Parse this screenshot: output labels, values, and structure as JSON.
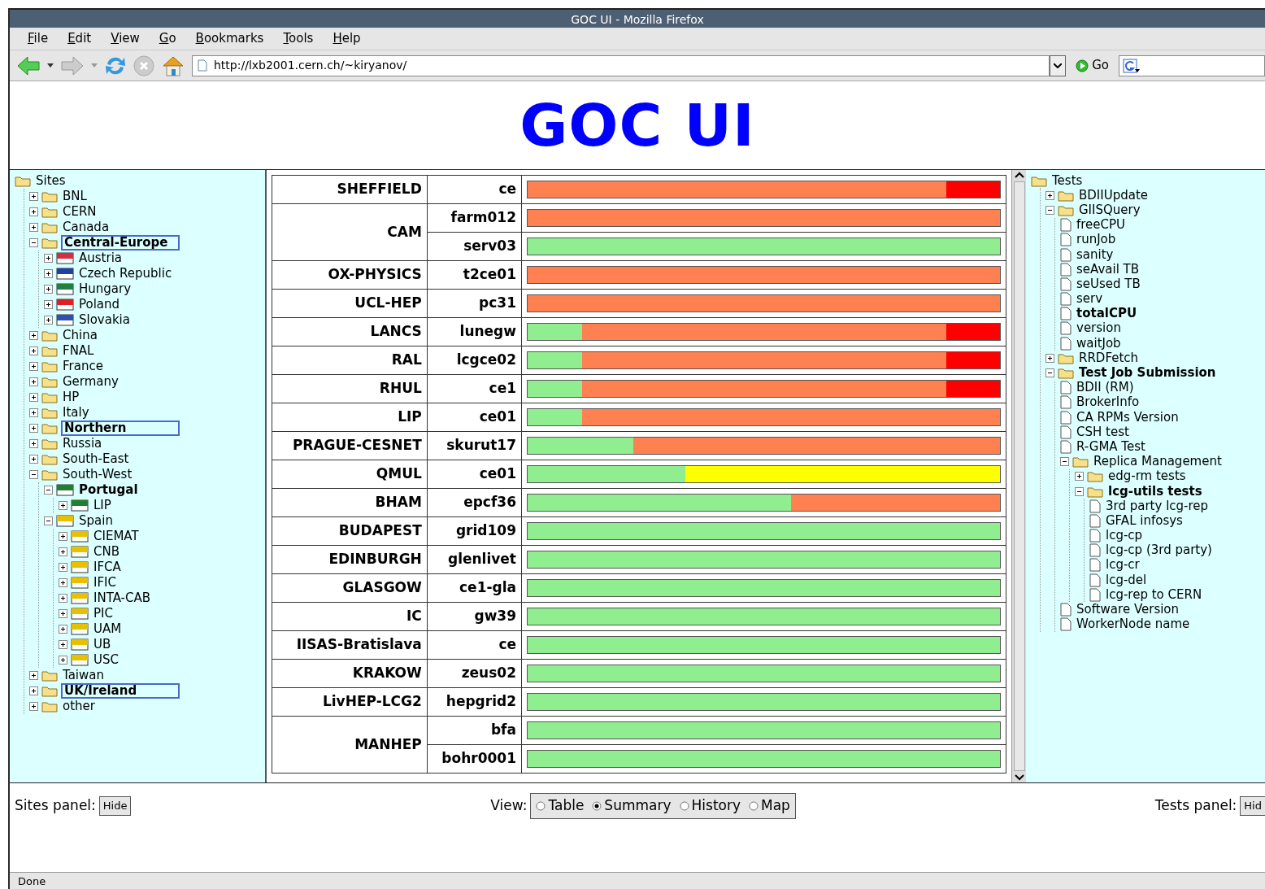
{
  "window": {
    "title": "GOC UI - Mozilla Firefox"
  },
  "menu": [
    "File",
    "Edit",
    "View",
    "Go",
    "Bookmarks",
    "Tools",
    "Help"
  ],
  "toolbar": {
    "address": "http://lxb2001.cern.ch/~kiryanov/",
    "go": "Go"
  },
  "page_title": "GOC UI",
  "sites_tree": {
    "label": "Sites",
    "kind": "folder",
    "children": [
      {
        "label": "BNL",
        "kind": "folder",
        "expanded": false
      },
      {
        "label": "CERN",
        "kind": "folder",
        "expanded": false
      },
      {
        "label": "Canada",
        "kind": "folder",
        "expanded": false
      },
      {
        "label": "Central-Europe",
        "kind": "folder",
        "expanded": true,
        "highlighted": true,
        "bold": true,
        "children": [
          {
            "label": "Austria",
            "kind": "flag",
            "color": "#d03040",
            "expanded": false
          },
          {
            "label": "Czech Republic",
            "kind": "flag",
            "color": "#2040a0",
            "expanded": false
          },
          {
            "label": "Hungary",
            "kind": "flag",
            "color": "#208040",
            "expanded": false
          },
          {
            "label": "Poland",
            "kind": "flag",
            "color": "#e02020",
            "expanded": false
          },
          {
            "label": "Slovakia",
            "kind": "flag",
            "color": "#3050b0",
            "expanded": false
          }
        ]
      },
      {
        "label": "China",
        "kind": "folder",
        "expanded": false
      },
      {
        "label": "FNAL",
        "kind": "folder",
        "expanded": false
      },
      {
        "label": "France",
        "kind": "folder",
        "expanded": false
      },
      {
        "label": "Germany",
        "kind": "folder",
        "expanded": false
      },
      {
        "label": "HP",
        "kind": "folder",
        "expanded": false
      },
      {
        "label": "Italy",
        "kind": "folder",
        "expanded": false
      },
      {
        "label": "Northern",
        "kind": "folder",
        "expanded": false,
        "highlighted": true,
        "bold": true
      },
      {
        "label": "Russia",
        "kind": "folder",
        "expanded": false
      },
      {
        "label": "South-East",
        "kind": "folder",
        "expanded": false
      },
      {
        "label": "South-West",
        "kind": "folder",
        "expanded": true,
        "children": [
          {
            "label": "Portugal",
            "kind": "flag",
            "color": "#208030",
            "expanded": true,
            "bold": true,
            "children": [
              {
                "label": "LIP",
                "kind": "flag",
                "color": "#208030",
                "expanded": false
              }
            ]
          },
          {
            "label": "Spain",
            "kind": "flag",
            "color": "#e8c000",
            "expanded": true,
            "children": [
              {
                "label": "CIEMAT",
                "kind": "flag",
                "color": "#e8c000",
                "expanded": false
              },
              {
                "label": "CNB",
                "kind": "flag",
                "color": "#e8c000",
                "expanded": false
              },
              {
                "label": "IFCA",
                "kind": "flag",
                "color": "#e8c000",
                "expanded": false
              },
              {
                "label": "IFIC",
                "kind": "flag",
                "color": "#e8c000",
                "expanded": false
              },
              {
                "label": "INTA-CAB",
                "kind": "flag",
                "color": "#e8c000",
                "expanded": false
              },
              {
                "label": "PIC",
                "kind": "flag",
                "color": "#e8c000",
                "expanded": false
              },
              {
                "label": "UAM",
                "kind": "flag",
                "color": "#e8c000",
                "expanded": false
              },
              {
                "label": "UB",
                "kind": "flag",
                "color": "#e8c000",
                "expanded": false
              },
              {
                "label": "USC",
                "kind": "flag",
                "color": "#e8c000",
                "expanded": false
              }
            ]
          }
        ]
      },
      {
        "label": "Taiwan",
        "kind": "folder",
        "expanded": false
      },
      {
        "label": "UK/Ireland",
        "kind": "folder",
        "expanded": false,
        "highlighted": true,
        "bold": true
      },
      {
        "label": "other",
        "kind": "folder",
        "expanded": false
      }
    ]
  },
  "summary": {
    "rows": [
      {
        "site": "SHEFFIELD",
        "hosts": [
          {
            "name": "ce",
            "segments": [
              {
                "color": "#ff8050",
                "level": 0.887
              },
              {
                "color": "#ff0000",
                "level": 1
              }
            ]
          }
        ]
      },
      {
        "site": "CAM",
        "hosts": [
          {
            "name": "farm012",
            "segments": [
              {
                "color": "#ff8050",
                "level": 1
              }
            ]
          },
          {
            "name": "serv03",
            "segments": [
              {
                "color": "#90ee90",
                "level": 1
              }
            ]
          }
        ]
      },
      {
        "site": "OX-PHYSICS",
        "hosts": [
          {
            "name": "t2ce01",
            "segments": [
              {
                "color": "#ff8050",
                "level": 1
              }
            ]
          }
        ]
      },
      {
        "site": "UCL-HEP",
        "hosts": [
          {
            "name": "pc31",
            "segments": [
              {
                "color": "#ff8050",
                "level": 1
              }
            ]
          }
        ]
      },
      {
        "site": "LANCS",
        "hosts": [
          {
            "name": "lunegw",
            "segments": [
              {
                "color": "#90ee90",
                "level": 0.115
              },
              {
                "color": "#ff8050",
                "level": 0.887
              },
              {
                "color": "#ff0000",
                "level": 1
              }
            ]
          }
        ]
      },
      {
        "site": "RAL",
        "hosts": [
          {
            "name": "lcgce02",
            "segments": [
              {
                "color": "#90ee90",
                "level": 0.115
              },
              {
                "color": "#ff8050",
                "level": 0.887
              },
              {
                "color": "#ff0000",
                "level": 1
              }
            ]
          }
        ]
      },
      {
        "site": "RHUL",
        "hosts": [
          {
            "name": "ce1",
            "segments": [
              {
                "color": "#90ee90",
                "level": 0.115
              },
              {
                "color": "#ff8050",
                "level": 0.887
              },
              {
                "color": "#ff0000",
                "level": 1
              }
            ]
          }
        ]
      },
      {
        "site": "LIP",
        "hosts": [
          {
            "name": "ce01",
            "segments": [
              {
                "color": "#90ee90",
                "level": 0.115
              },
              {
                "color": "#ff8050",
                "level": 1
              }
            ]
          }
        ]
      },
      {
        "site": "PRAGUE-CESNET",
        "hosts": [
          {
            "name": "skurut17",
            "segments": [
              {
                "color": "#90ee90",
                "level": 0.224
              },
              {
                "color": "#ff8050",
                "level": 1
              }
            ]
          }
        ]
      },
      {
        "site": "QMUL",
        "hosts": [
          {
            "name": "ce01",
            "segments": [
              {
                "color": "#90ee90",
                "level": 0.334
              },
              {
                "color": "#ffff00",
                "level": 1
              }
            ]
          }
        ]
      },
      {
        "site": "BHAM",
        "hosts": [
          {
            "name": "epcf36",
            "segments": [
              {
                "color": "#90ee90",
                "level": 0.557
              },
              {
                "color": "#ff8050",
                "level": 1
              }
            ]
          }
        ]
      },
      {
        "site": "BUDAPEST",
        "hosts": [
          {
            "name": "grid109",
            "segments": [
              {
                "color": "#90ee90",
                "level": 1
              }
            ]
          }
        ]
      },
      {
        "site": "EDINBURGH",
        "hosts": [
          {
            "name": "glenlivet",
            "segments": [
              {
                "color": "#90ee90",
                "level": 1
              }
            ]
          }
        ]
      },
      {
        "site": "GLASGOW",
        "hosts": [
          {
            "name": "ce1-gla",
            "segments": [
              {
                "color": "#90ee90",
                "level": 1
              }
            ]
          }
        ]
      },
      {
        "site": "IC",
        "hosts": [
          {
            "name": "gw39",
            "segments": [
              {
                "color": "#90ee90",
                "level": 1
              }
            ]
          }
        ]
      },
      {
        "site": "IISAS-Bratislava",
        "hosts": [
          {
            "name": "ce",
            "segments": [
              {
                "color": "#90ee90",
                "level": 1
              }
            ]
          }
        ]
      },
      {
        "site": "KRAKOW",
        "hosts": [
          {
            "name": "zeus02",
            "segments": [
              {
                "color": "#90ee90",
                "level": 1
              }
            ]
          }
        ]
      },
      {
        "site": "LivHEP-LCG2",
        "hosts": [
          {
            "name": "hepgrid2",
            "segments": [
              {
                "color": "#90ee90",
                "level": 1
              }
            ]
          }
        ]
      },
      {
        "site": "MANHEP",
        "hosts": [
          {
            "name": "bfa",
            "segments": [
              {
                "color": "#90ee90",
                "level": 1
              }
            ]
          },
          {
            "name": "bohr0001",
            "segments": [
              {
                "color": "#90ee90",
                "level": 1
              }
            ]
          }
        ]
      }
    ]
  },
  "tests_tree": {
    "label": "Tests",
    "kind": "folder",
    "children": [
      {
        "label": "BDIIUpdate",
        "kind": "folder",
        "expanded": false
      },
      {
        "label": "GIISQuery",
        "kind": "folder",
        "expanded": true,
        "children": [
          {
            "label": "freeCPU",
            "kind": "page"
          },
          {
            "label": "runJob",
            "kind": "page"
          },
          {
            "label": "sanity",
            "kind": "page"
          },
          {
            "label": "seAvail TB",
            "kind": "page"
          },
          {
            "label": "seUsed TB",
            "kind": "page"
          },
          {
            "label": "serv",
            "kind": "page"
          },
          {
            "label": "totalCPU",
            "kind": "page",
            "bold": true
          },
          {
            "label": "version",
            "kind": "page"
          },
          {
            "label": "waitJob",
            "kind": "page"
          }
        ]
      },
      {
        "label": "RRDFetch",
        "kind": "folder",
        "expanded": false
      },
      {
        "label": "Test Job Submission",
        "kind": "folder",
        "expanded": true,
        "bold": true,
        "children": [
          {
            "label": "BDII (RM)",
            "kind": "page"
          },
          {
            "label": "BrokerInfo",
            "kind": "page"
          },
          {
            "label": "CA RPMs Version",
            "kind": "page"
          },
          {
            "label": "CSH test",
            "kind": "page"
          },
          {
            "label": "R-GMA Test",
            "kind": "page"
          },
          {
            "label": "Replica Management",
            "kind": "folder",
            "expanded": true,
            "children": [
              {
                "label": "edg-rm tests",
                "kind": "folder",
                "expanded": false
              },
              {
                "label": "lcg-utils tests",
                "kind": "folder",
                "expanded": true,
                "bold": true,
                "children": [
                  {
                    "label": "3rd party lcg-rep",
                    "kind": "page"
                  },
                  {
                    "label": "GFAL infosys",
                    "kind": "page"
                  },
                  {
                    "label": "lcg-cp",
                    "kind": "page"
                  },
                  {
                    "label": "lcg-cp (3rd party)",
                    "kind": "page"
                  },
                  {
                    "label": "lcg-cr",
                    "kind": "page"
                  },
                  {
                    "label": "lcg-del",
                    "kind": "page"
                  },
                  {
                    "label": "lcg-rep to CERN",
                    "kind": "page"
                  }
                ]
              }
            ]
          },
          {
            "label": "Software Version",
            "kind": "page"
          },
          {
            "label": "WorkerNode name",
            "kind": "page"
          }
        ]
      }
    ]
  },
  "controls": {
    "sites_panel_label": "Sites panel:",
    "sites_hide": "Hide",
    "view_label": "View:",
    "views": [
      {
        "label": "Table",
        "selected": false
      },
      {
        "label": "Summary",
        "selected": true
      },
      {
        "label": "History",
        "selected": false
      },
      {
        "label": "Map",
        "selected": false
      }
    ],
    "tests_panel_label": "Tests panel:",
    "tests_hide": "Hid"
  },
  "status_bar": "Done"
}
